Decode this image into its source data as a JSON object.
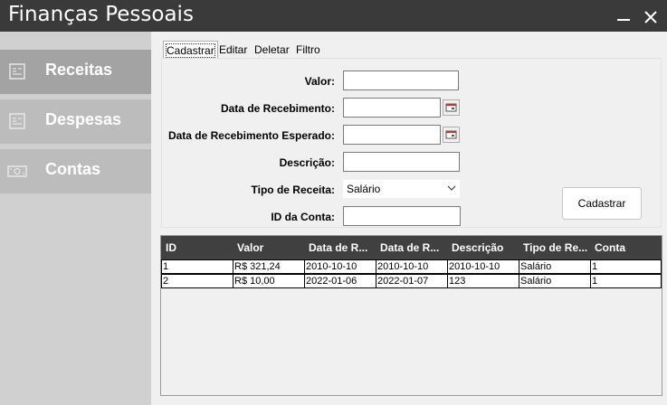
{
  "app": {
    "title": "Finanças Pessoais"
  },
  "window": {
    "minimize_icon": "minimize-icon",
    "close_icon": "close-icon"
  },
  "sidebar": {
    "items": [
      {
        "label": "Receitas",
        "icon": "receipt-icon",
        "active": true
      },
      {
        "label": "Despesas",
        "icon": "receipt-icon",
        "active": false
      },
      {
        "label": "Contas",
        "icon": "banknote-icon",
        "active": false
      }
    ]
  },
  "tabs": [
    {
      "label": "Cadastrar",
      "active": true
    },
    {
      "label": "Editar",
      "active": false
    },
    {
      "label": "Deletar",
      "active": false
    },
    {
      "label": "Filtro",
      "active": false
    }
  ],
  "form": {
    "valor": {
      "label": "Valor:",
      "value": ""
    },
    "data_recebimento": {
      "label": "Data de Recebimento:",
      "value": ""
    },
    "data_recebimento_esperado": {
      "label": "Data de Recebimento Esperado:",
      "value": ""
    },
    "descricao": {
      "label": "Descrição:",
      "value": ""
    },
    "tipo_receita": {
      "label": "Tipo de Receita:",
      "selected": "Salário"
    },
    "id_conta": {
      "label": "ID da Conta:",
      "value": ""
    },
    "submit_label": "Cadastrar"
  },
  "table": {
    "columns": [
      "ID",
      "Valor",
      "Data de R...",
      "Data de R...",
      "Descrição",
      "Tipo de Re...",
      "Conta"
    ],
    "rows": [
      [
        "1",
        "R$ 321,24",
        "2010-10-10",
        "2010-10-10",
        "2010-10-10",
        "Salário",
        "1"
      ],
      [
        "2",
        "R$ 10,00",
        "2022-01-06",
        "2022-01-07",
        "123",
        "Salário",
        "1"
      ]
    ]
  },
  "colors": {
    "titlebar": "#3a3a3a",
    "sidebar_active": "#a3a3a3",
    "sidebar_item": "#bcbcbc",
    "table_header": "#404040"
  }
}
